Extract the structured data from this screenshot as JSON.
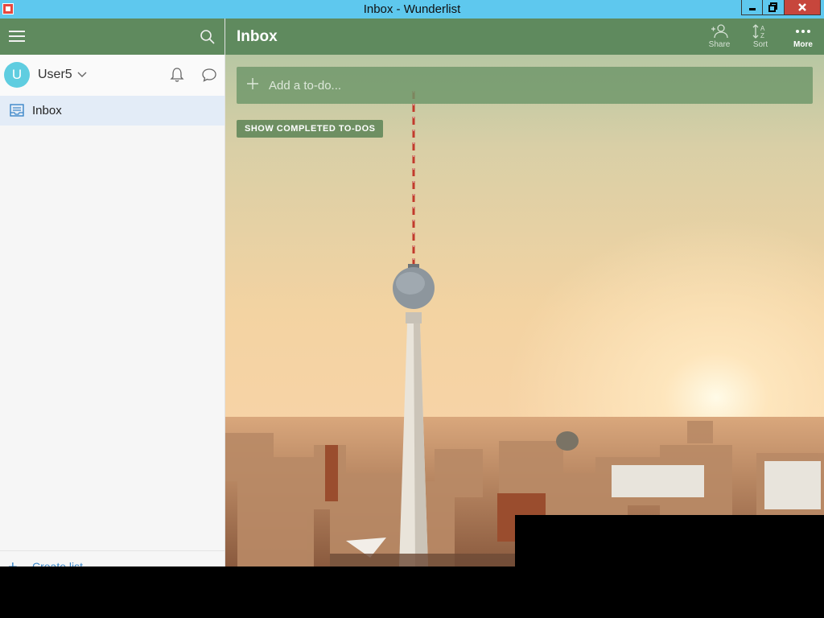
{
  "window": {
    "title": "Inbox - Wunderlist",
    "title_bar_color": "#5ec8ee"
  },
  "sidebar": {
    "header_color": "#5f8a5e",
    "user": {
      "avatar_initial": "U",
      "avatar_color": "#5fcde0",
      "name": "User5"
    },
    "lists": [
      {
        "label": "Inbox",
        "icon": "inbox-icon",
        "selected": true
      }
    ],
    "create_list_label": "Create list"
  },
  "main": {
    "list_title": "Inbox",
    "toolbar": {
      "share_label": "Share",
      "sort_label": "Sort",
      "more_label": "More"
    },
    "add_todo_placeholder": "Add a to-do...",
    "show_completed_label": "SHOW COMPLETED TO-DOS",
    "background": "Berlin TV tower at sunset"
  }
}
